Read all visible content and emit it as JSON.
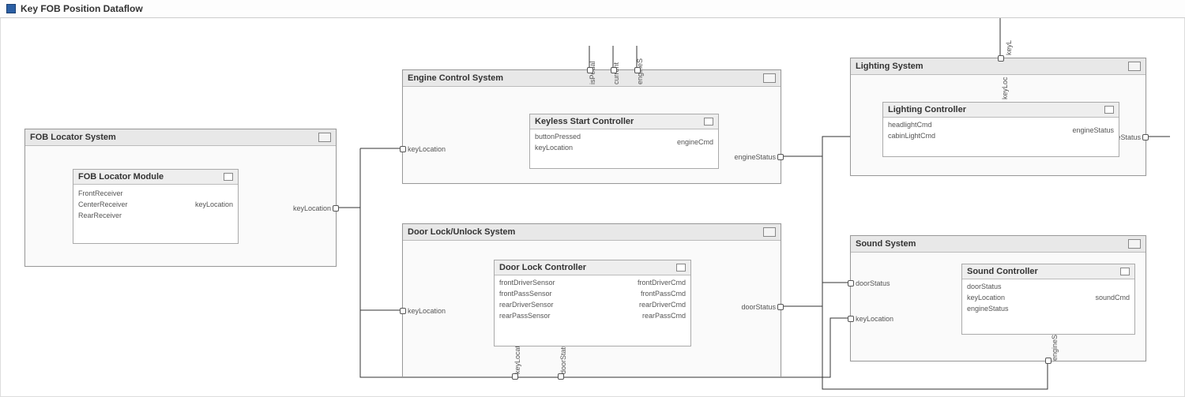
{
  "title": "Key FOB Position Dataflow",
  "blocks": {
    "fob_locator_system": {
      "title": "FOB Locator System",
      "module": {
        "title": "FOB Locator Module",
        "inputs": [
          "FrontReceiver",
          "CenterReceiver",
          "RearReceiver"
        ],
        "outputs": [
          "keyLocation"
        ]
      },
      "outputs": [
        "keyLocation"
      ]
    },
    "engine_control_system": {
      "title": "Engine Control System",
      "top_ports": [
        "isPedal",
        "current",
        "engineS"
      ],
      "left_ports": [
        "keyLocation"
      ],
      "right_ports": [
        "engineStatus"
      ],
      "controller": {
        "title": "Keyless Start Controller",
        "inputs": [
          "buttonPressed",
          "keyLocation"
        ],
        "outputs": [
          "engineCmd"
        ]
      }
    },
    "door_lock_system": {
      "title": "Door Lock/Unlock System",
      "left_ports": [
        "keyLocation"
      ],
      "right_ports": [
        "doorStatus"
      ],
      "bottom_ports": [
        "keyLocation",
        "doorStatus"
      ],
      "controller": {
        "title": "Door Lock Controller",
        "inputs": [
          "frontDriverSensor",
          "frontPassSensor",
          "rearDriverSensor",
          "rearPassSensor"
        ],
        "outputs": [
          "frontDriverCmd",
          "frontPassCmd",
          "rearDriverCmd",
          "rearPassCmd"
        ]
      }
    },
    "lighting_system": {
      "title": "Lighting System",
      "top_ports": [
        "keyL"
      ],
      "left_port_v": "keyLoc",
      "right_ports": [
        "engineStatus"
      ],
      "controller": {
        "title": "Lighting Controller",
        "inputs": [
          "headlightCmd",
          "cabinLightCmd"
        ],
        "outputs": [
          "engineStatus"
        ]
      }
    },
    "sound_system": {
      "title": "Sound System",
      "left_ports": [
        "doorStatus",
        "keyLocation"
      ],
      "bottom_ports": [
        "engineStatus"
      ],
      "controller": {
        "title": "Sound Controller",
        "inputs": [
          "doorStatus",
          "keyLocation",
          "engineStatus"
        ],
        "outputs": [
          "soundCmd"
        ]
      }
    }
  }
}
